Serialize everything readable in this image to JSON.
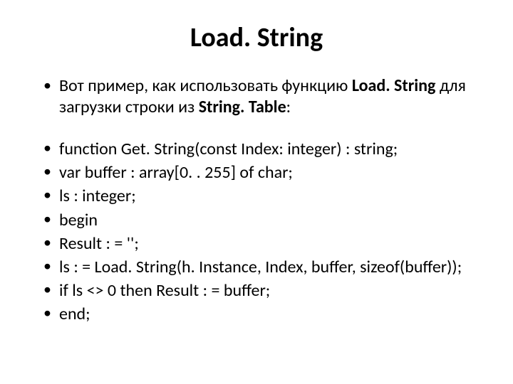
{
  "title": "Load. String",
  "intro": {
    "prefix": "Вот пример, как использовать функцию ",
    "bold1": "Load. String",
    "mid": " для загрузки строки из ",
    "bold2": "String. Table",
    "suffix": ":"
  },
  "code": [
    "function Get. String(const Index: integer) : string;",
    "var buffer : array[0. . 255] of char;",
    "ls : integer;",
    "begin",
    "Result : = '';",
    "ls : = Load. String(h. Instance, Index, buffer, sizeof(buffer));",
    "if ls <> 0 then Result : = buffer;",
    "end;"
  ]
}
